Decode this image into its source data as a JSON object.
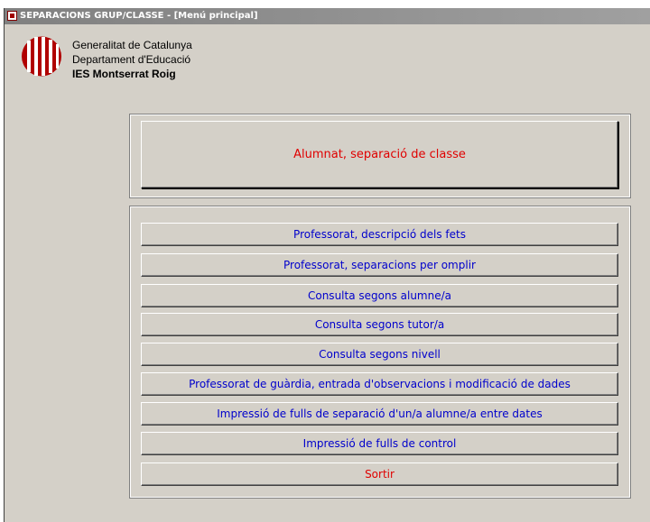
{
  "window": {
    "title": "SEPARACIONS GRUP/CLASSE - [Menú principal]"
  },
  "header": {
    "org_line1": "Generalitat de Catalunya",
    "org_line2": "Departament d'Educació",
    "org_line3": "IES Montserrat Roig"
  },
  "main": {
    "primary_button": "Alumnat, separació de classe",
    "buttons": [
      "Professorat, descripció dels fets",
      "Professorat, separacions per omplir",
      "Consulta segons alumne/a",
      "Consulta segons tutor/a",
      "Consulta segons nivell",
      "Professorat de guàrdia, entrada d'observacions i modificació de dades",
      "Impressió de fulls de separació d'un/a alumne/a entre dates",
      "Impressió de fulls de control",
      "Sortir"
    ]
  },
  "colors": {
    "accent_red": "#e00000",
    "button_blue": "#0000cc",
    "window_bg": "#d4d0c8"
  }
}
